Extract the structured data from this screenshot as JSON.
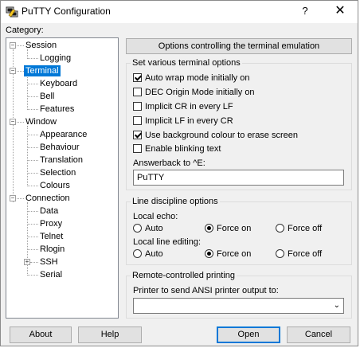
{
  "window": {
    "title": "PuTTY Configuration",
    "help_glyph": "?",
    "close_glyph": "✕"
  },
  "category_label": "Category:",
  "tree": {
    "session": "Session",
    "logging": "Logging",
    "terminal": "Terminal",
    "keyboard": "Keyboard",
    "bell": "Bell",
    "features": "Features",
    "window": "Window",
    "appearance": "Appearance",
    "behaviour": "Behaviour",
    "translation": "Translation",
    "selection": "Selection",
    "colours": "Colours",
    "connection": "Connection",
    "data": "Data",
    "proxy": "Proxy",
    "telnet": "Telnet",
    "rlogin": "Rlogin",
    "ssh": "SSH",
    "serial": "Serial",
    "selected": "Terminal"
  },
  "panel_header": "Options controlling the terminal emulation",
  "terminal_options": {
    "title": "Set various terminal options",
    "items": [
      {
        "label": "Auto wrap mode initially on",
        "checked": true
      },
      {
        "label": "DEC Origin Mode initially on",
        "checked": false
      },
      {
        "label": "Implicit CR in every LF",
        "checked": false
      },
      {
        "label": "Implicit LF in every CR",
        "checked": false
      },
      {
        "label": "Use background colour to erase screen",
        "checked": true
      },
      {
        "label": "Enable blinking text",
        "checked": false
      }
    ],
    "answerback_label": "Answerback to ^E:",
    "answerback_value": "PuTTY"
  },
  "line_discipline": {
    "title": "Line discipline options",
    "local_echo_label": "Local echo:",
    "local_edit_label": "Local line editing:",
    "options": [
      "Auto",
      "Force on",
      "Force off"
    ],
    "local_echo_selected": "Force on",
    "local_edit_selected": "Force on"
  },
  "remote_printing": {
    "title": "Remote-controlled printing",
    "printer_label": "Printer to send ANSI printer output to:",
    "printer_value": ""
  },
  "buttons": {
    "about": "About",
    "help": "Help",
    "open": "Open",
    "cancel": "Cancel"
  }
}
